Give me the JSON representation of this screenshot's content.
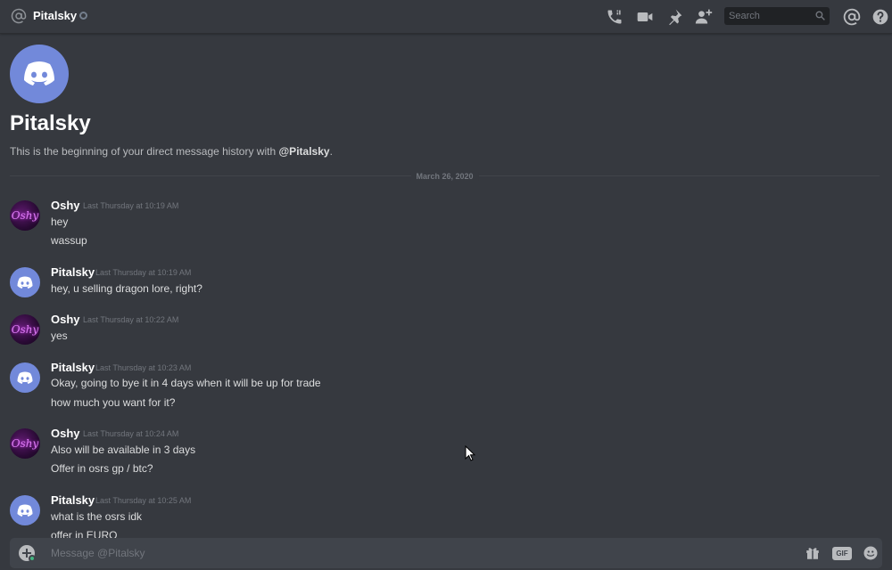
{
  "header": {
    "channel_name": "Pitalsky",
    "search_placeholder": "Search"
  },
  "intro": {
    "name": "Pitalsky",
    "text_prefix": "This is the beginning of your direct message history with ",
    "mention": "@Pitalsky",
    "text_suffix": "."
  },
  "date_divider": "March 26, 2020",
  "messages": [
    {
      "author": "Oshy",
      "timestamp": "Last Thursday at 10:19 AM",
      "avatar": "oshy-avatar",
      "lines": [
        "hey",
        "wassup"
      ]
    },
    {
      "author": "Pitalsky",
      "timestamp": "Last Thursday at 10:19 AM",
      "avatar": "discord-avatar",
      "lines": [
        "hey, u selling dragon lore, right?"
      ]
    },
    {
      "author": "Oshy",
      "timestamp": "Last Thursday at 10:22 AM",
      "avatar": "oshy-avatar",
      "lines": [
        "yes"
      ]
    },
    {
      "author": "Pitalsky",
      "timestamp": "Last Thursday at 10:23 AM",
      "avatar": "discord-avatar",
      "lines": [
        "Okay, going to bye it in 4 days when it will be up for trade",
        "how much you want for it?"
      ]
    },
    {
      "author": "Oshy",
      "timestamp": "Last Thursday at 10:24 AM",
      "avatar": "oshy-avatar",
      "lines": [
        "Also will be available in 3 days",
        "Offer in osrs gp / btc?"
      ]
    },
    {
      "author": "Pitalsky",
      "timestamp": "Last Thursday at 10:25 AM",
      "avatar": "discord-avatar",
      "lines": [
        "what is the osrs idk",
        "offer in EURO"
      ]
    }
  ],
  "oshy_avatar_text": "Oshy",
  "composer": {
    "placeholder": "Message @Pitalsky",
    "gif_label": "GIF"
  },
  "colors": {
    "background": "#36393f",
    "blurple": "#7289da",
    "composer": "#40444b",
    "online": "#43b581"
  },
  "icons": [
    "at-icon",
    "call-icon",
    "video-icon",
    "pin-icon",
    "add-friend-icon",
    "search-icon",
    "mention-icon",
    "help-icon",
    "attach-plus-icon",
    "gift-icon",
    "gif-icon",
    "emoji-icon"
  ]
}
